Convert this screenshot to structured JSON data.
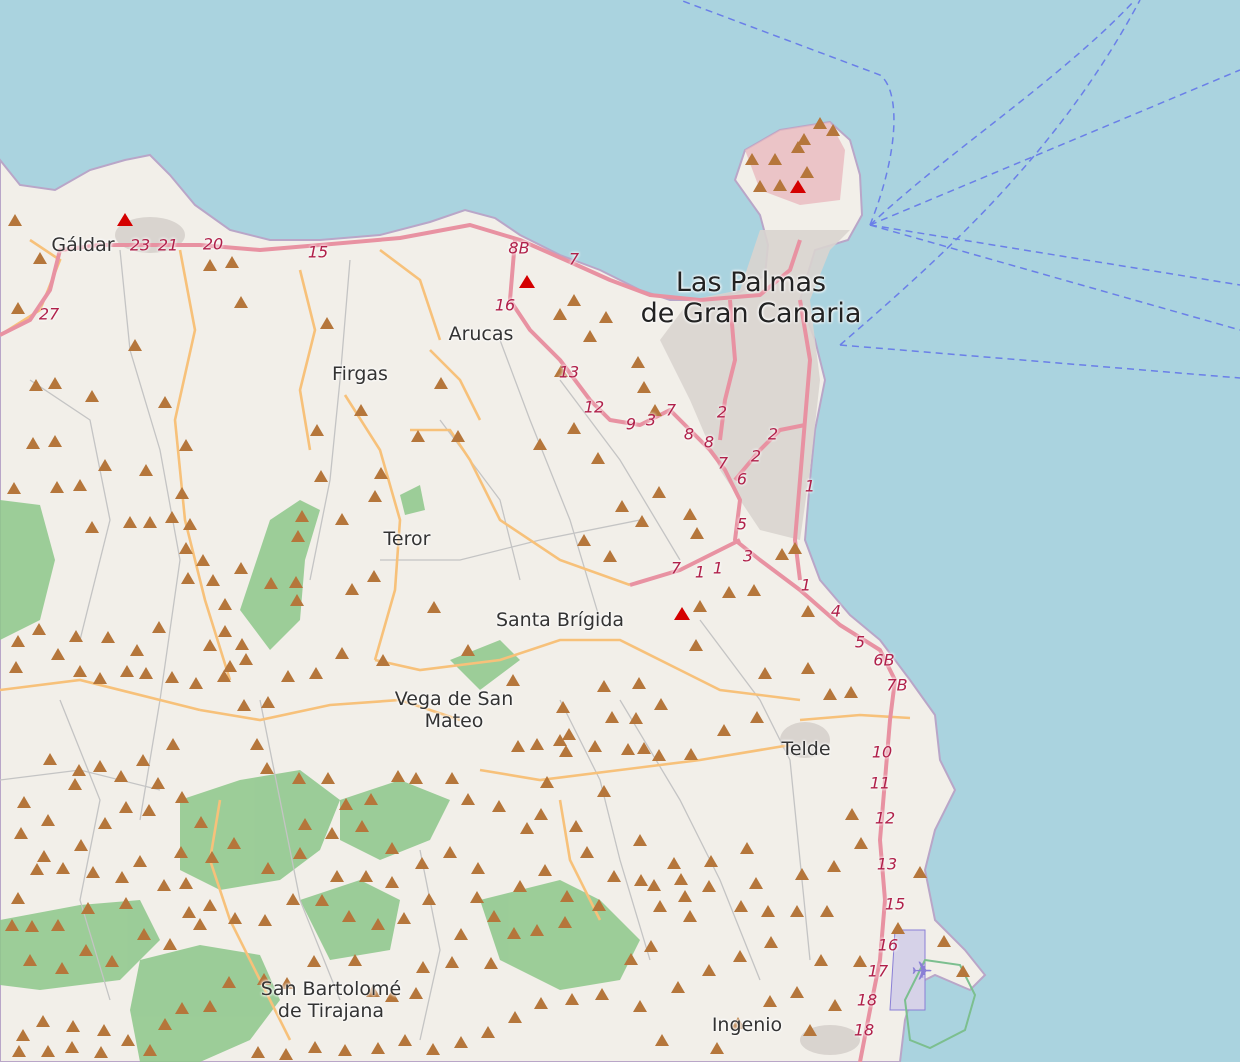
{
  "map": {
    "colors": {
      "sea": "#aad3df",
      "land": "#f2efe9",
      "forest": "#8dc78a",
      "motorway": "#e892a2",
      "secondary": "#f7c17a",
      "minor_road": "#c8c8c8",
      "peak": "#b5763b",
      "volcano": "#d40000",
      "ferry": "#6a7fe8",
      "urban": "#d9d4cf",
      "airport": "#8a7fd6"
    },
    "places": [
      {
        "id": "galdar",
        "name": "Gáldar"
      },
      {
        "id": "arucas",
        "name": "Arucas"
      },
      {
        "id": "firgas",
        "name": "Firgas"
      },
      {
        "id": "teror",
        "name": "Teror"
      },
      {
        "id": "santa-brigida",
        "name": "Santa Brígida"
      },
      {
        "id": "vega-de-san-mateo",
        "name": "Vega de San\nMateo"
      },
      {
        "id": "telde",
        "name": "Telde"
      },
      {
        "id": "san-bartolome",
        "name": "San Bartolomé\nde Tirajana"
      },
      {
        "id": "ingenio",
        "name": "Ingenio"
      }
    ],
    "capital": {
      "name": "Las Palmas\nde Gran Canaria"
    },
    "road_refs": [
      "23",
      "21",
      "20",
      "15",
      "27",
      "8B",
      "7",
      "16",
      "13",
      "12",
      "9",
      "3",
      "7",
      "2",
      "8",
      "8",
      "7",
      "2",
      "2",
      "6",
      "1",
      "5",
      "3",
      "7",
      "1",
      "1",
      "1",
      "4",
      "5",
      "6B",
      "7B",
      "10",
      "11",
      "12",
      "13",
      "15",
      "16",
      "17",
      "18",
      "18"
    ],
    "icons": [
      "peak-icon",
      "volcano-icon",
      "airport-icon"
    ]
  }
}
